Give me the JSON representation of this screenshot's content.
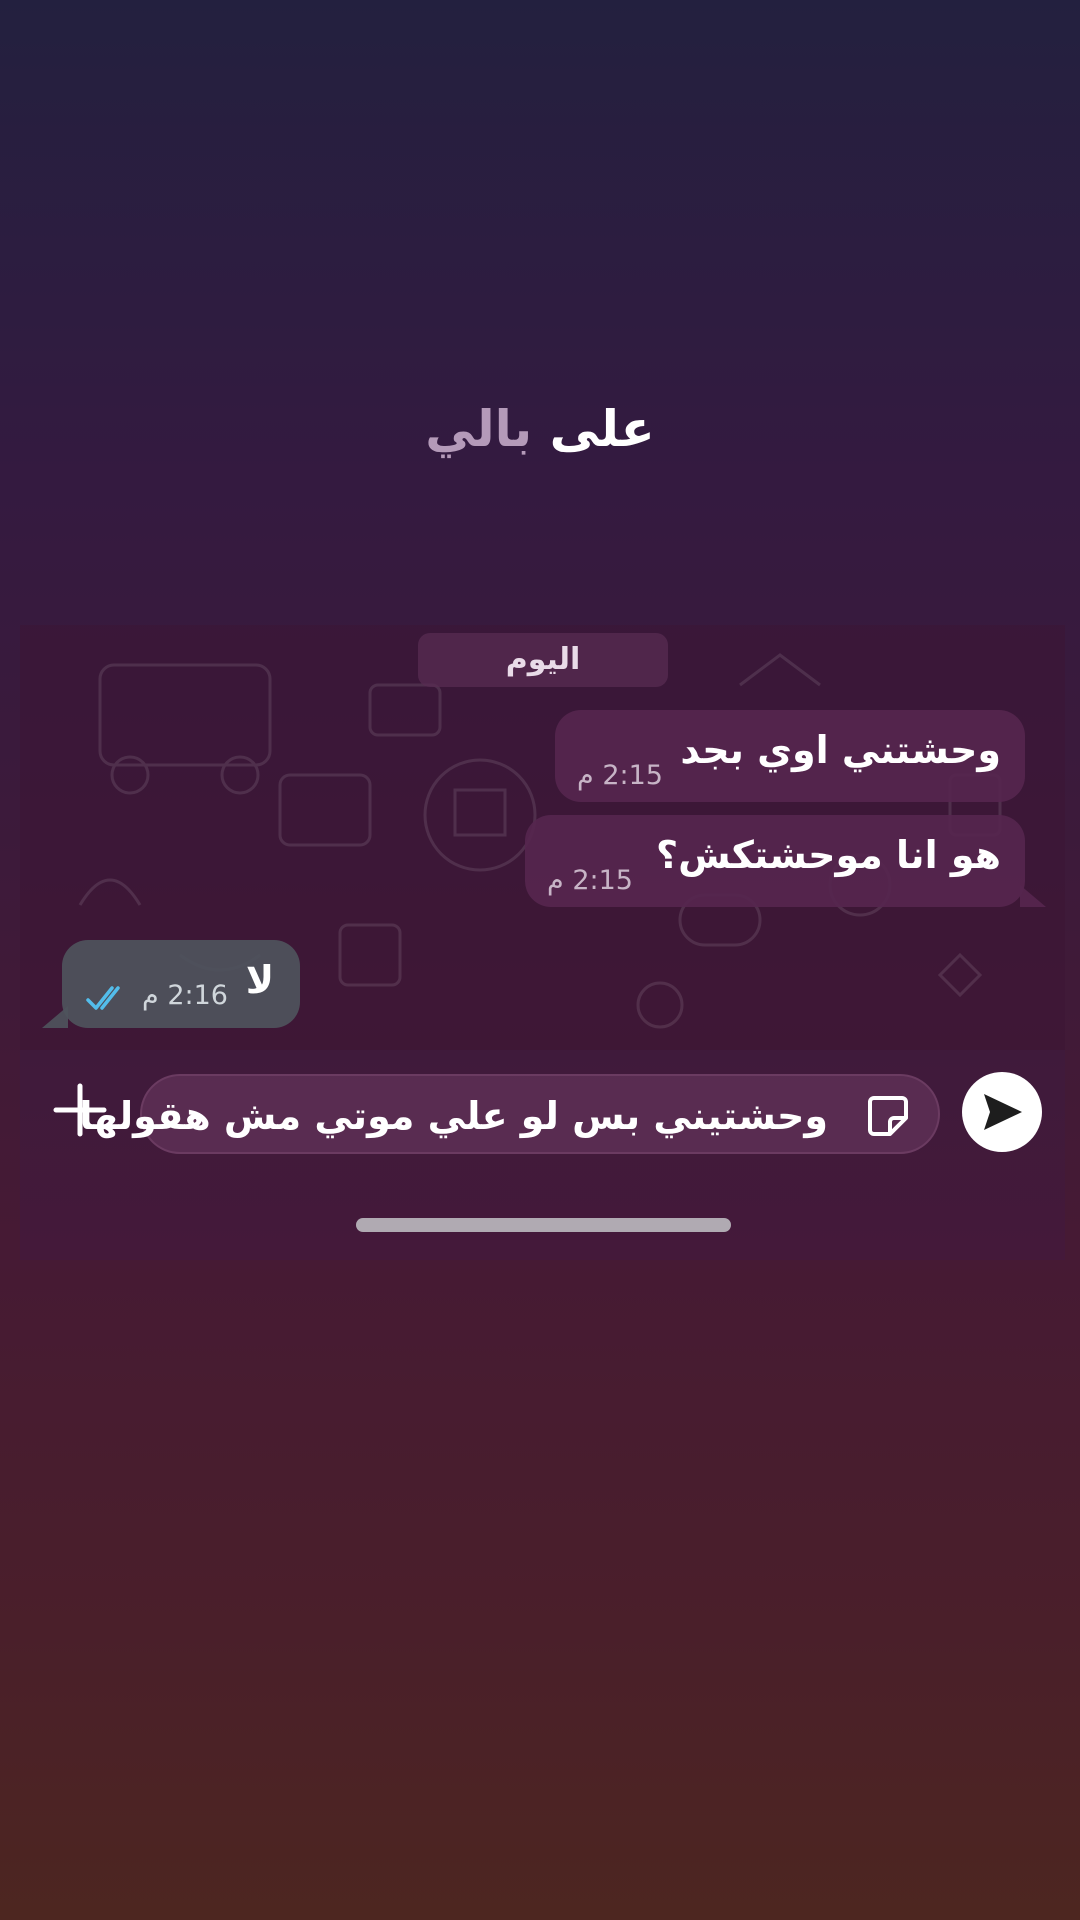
{
  "overlay_title": {
    "word1": "على",
    "word2": "بالي"
  },
  "chat": {
    "date_chip": "اليوم",
    "messages": [
      {
        "text": "وحشتني اوي بجد",
        "time": "2:15 م",
        "direction": "incoming"
      },
      {
        "text": "هو انا موحشتكش؟",
        "time": "2:15 م",
        "direction": "incoming"
      },
      {
        "text": "لا",
        "time": "2:16 م",
        "direction": "outgoing",
        "status": "read"
      }
    ]
  },
  "composer": {
    "input_value": "وحشتيني بس لو علي موتي مش هقولها",
    "plus_icon": "plus-icon",
    "sticker_icon": "sticker-icon",
    "send_icon": "send-icon"
  },
  "colors": {
    "read_ticks": "#53bdeb",
    "incoming_bubble": "#56264e",
    "outgoing_bubble": "#4e545c"
  }
}
